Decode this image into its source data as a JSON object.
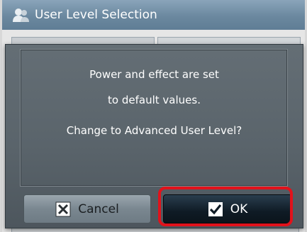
{
  "window": {
    "title": "User Level Selection",
    "title_icon": "user-icon"
  },
  "dialog": {
    "line1": "Power and effect are set",
    "line2": "to default values.",
    "line3": "Change to Advanced User Level?",
    "cancel_label": "Cancel",
    "cancel_icon": "close-icon",
    "ok_label": "OK",
    "ok_icon": "check-icon"
  },
  "colors": {
    "highlight": "#e1121b",
    "dialog_bg": "#5a646b",
    "ok_button": "#0f1b25",
    "cancel_button": "#7a8790"
  }
}
